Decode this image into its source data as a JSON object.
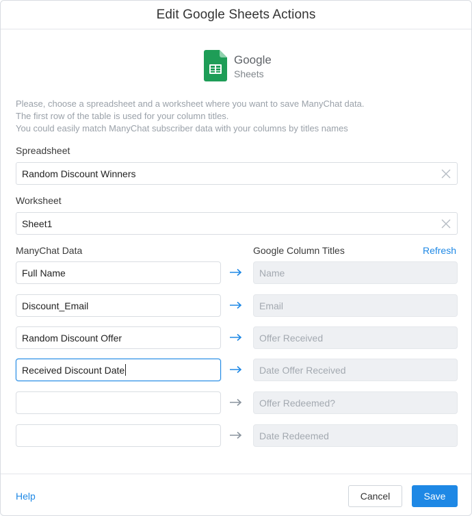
{
  "header": {
    "title": "Edit Google Sheets Actions"
  },
  "logo": {
    "icon": "google-sheets-icon",
    "brand": "Google",
    "product": "Sheets",
    "color": "#1e9d57"
  },
  "description": {
    "line1": "Please, choose a spreadsheet and a worksheet where you want to save ManyChat data.",
    "line2": "The first row of the table is used for your column titles.",
    "line3": "You could easily match ManyChat subscriber data with your columns by titles names"
  },
  "spreadsheet": {
    "label": "Spreadsheet",
    "value": "Random Discount Winners"
  },
  "worksheet": {
    "label": "Worksheet",
    "value": "Sheet1"
  },
  "mapping": {
    "left_header": "ManyChat Data",
    "right_header": "Google Column Titles",
    "refresh_label": "Refresh",
    "rows": [
      {
        "manychat": "Full Name",
        "column": "Name",
        "mapped": true
      },
      {
        "manychat": "Discount_Email",
        "column": "Email",
        "mapped": true
      },
      {
        "manychat": "Random Discount Offer",
        "column": "Offer Received",
        "mapped": true
      },
      {
        "manychat": "Received Discount Date",
        "column": "Date Offer Received",
        "mapped": true
      },
      {
        "manychat": "",
        "column": "Offer Redeemed?",
        "mapped": false
      },
      {
        "manychat": "",
        "column": "Date Redeemed",
        "mapped": false
      }
    ]
  },
  "footer": {
    "help_label": "Help",
    "cancel_label": "Cancel",
    "save_label": "Save"
  },
  "colors": {
    "accent": "#1e88e5",
    "arrow_active": "#1e88e5",
    "arrow_inactive": "#8a949e"
  }
}
